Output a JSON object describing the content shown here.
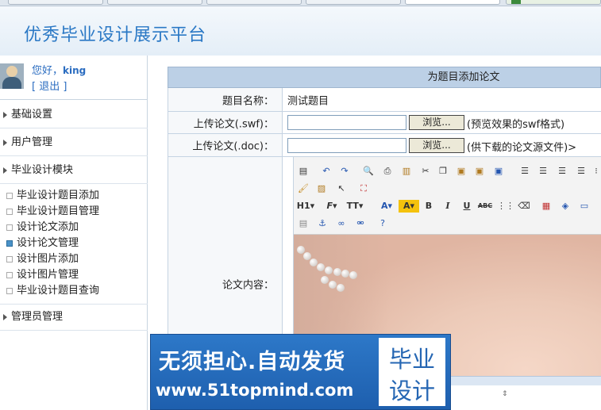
{
  "site": {
    "title": "优秀毕业设计展示平台"
  },
  "user": {
    "greeting": "您好，",
    "name": "king",
    "logout": "[ 退出 ]"
  },
  "sidebar": {
    "sections": [
      {
        "label": "基础设置"
      },
      {
        "label": "用户管理"
      },
      {
        "label": "毕业设计模块"
      },
      {
        "label": "管理员管理"
      }
    ],
    "items": [
      {
        "label": "毕业设计题目添加",
        "active": false
      },
      {
        "label": "毕业设计题目管理",
        "active": false
      },
      {
        "label": "设计论文添加",
        "active": false
      },
      {
        "label": "设计论文管理",
        "active": true
      },
      {
        "label": "设计图片添加",
        "active": false
      },
      {
        "label": "设计图片管理",
        "active": false
      },
      {
        "label": "毕业设计题目查询",
        "active": false
      }
    ]
  },
  "form": {
    "title": "为题目添加论文",
    "topic_label": "题目名称：",
    "topic_value": "测试题目",
    "swf_label": "上传论文(.swf)：",
    "swf_button": "浏览...",
    "swf_hint": "(预览效果的swf格式)",
    "doc_label": "上传论文(.doc)：",
    "doc_button": "浏览...",
    "doc_hint": "(供下载的论文源文件)>",
    "content_label": "论文内容："
  },
  "editor": {
    "heading_dropdown": "H1",
    "font_dropdown": "F",
    "size_dropdown": "TT",
    "bold": "B",
    "italic": "I",
    "underline": "U",
    "strike": "ABC"
  },
  "ad": {
    "slogan": "无须担心.自动发货",
    "url": "www.51topmind.com",
    "box_line1": "毕业",
    "box_line2": "设计"
  }
}
